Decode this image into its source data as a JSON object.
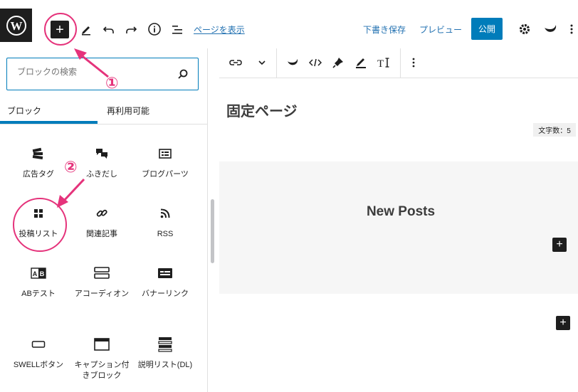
{
  "toolbar": {
    "add_label": "+",
    "view_page": "ページを表示",
    "save_draft": "下書き保存",
    "preview": "プレビュー",
    "publish": "公開"
  },
  "sidebar": {
    "search_placeholder": "ブロックの検索",
    "tabs": [
      "ブロック",
      "再利用可能"
    ],
    "blocks": [
      {
        "label": "広告タグ",
        "icon": "ad-tag-icon"
      },
      {
        "label": "ふきだし",
        "icon": "speech-bubble-icon"
      },
      {
        "label": "ブログパーツ",
        "icon": "blog-parts-icon"
      },
      {
        "label": "投稿リスト",
        "icon": "grid-icon"
      },
      {
        "label": "関連記事",
        "icon": "link-icon"
      },
      {
        "label": "RSS",
        "icon": "rss-icon"
      },
      {
        "label": "ABテスト",
        "icon": "ab-test-icon"
      },
      {
        "label": "アコーディオン",
        "icon": "accordion-icon"
      },
      {
        "label": "バナーリンク",
        "icon": "banner-icon"
      },
      {
        "label": "SWELLボタン",
        "icon": "button-icon"
      },
      {
        "label": "キャプション付きブロック",
        "icon": "caption-block-icon"
      },
      {
        "label": "説明リスト(DL)",
        "icon": "description-list-icon"
      }
    ]
  },
  "editor": {
    "page_title": "固定ページ",
    "char_count": "文字数：5",
    "new_posts": "New Posts"
  },
  "annotations": {
    "num1": "①",
    "num2": "②"
  },
  "colors": {
    "accent": "#007cba",
    "annotation": "#e5337b",
    "dark": "#1e1e1e"
  }
}
